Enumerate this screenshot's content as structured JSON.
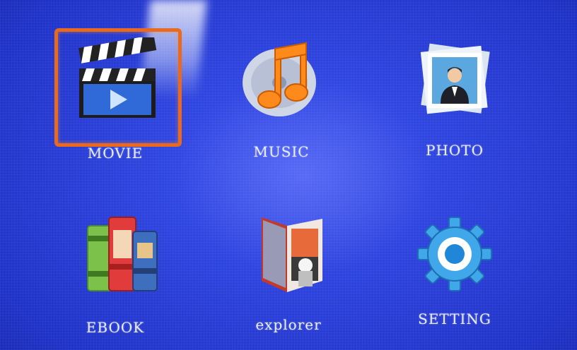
{
  "menu": {
    "items": [
      {
        "label": "MOVIE",
        "icon": "movie-clapperboard-icon",
        "selected": true
      },
      {
        "label": "MUSIC",
        "icon": "music-note-disc-icon",
        "selected": false
      },
      {
        "label": "PHOTO",
        "icon": "photo-portrait-icon",
        "selected": false
      },
      {
        "label": "EBOOK",
        "icon": "books-icon",
        "selected": false
      },
      {
        "label": "explorer",
        "icon": "file-explorer-icon",
        "selected": false
      },
      {
        "label": "SETTING",
        "icon": "gear-icon",
        "selected": false
      }
    ]
  },
  "colors": {
    "background": "#2a3fd8",
    "focus_border": "#e96a1e",
    "label_text": "#e8ecff"
  }
}
